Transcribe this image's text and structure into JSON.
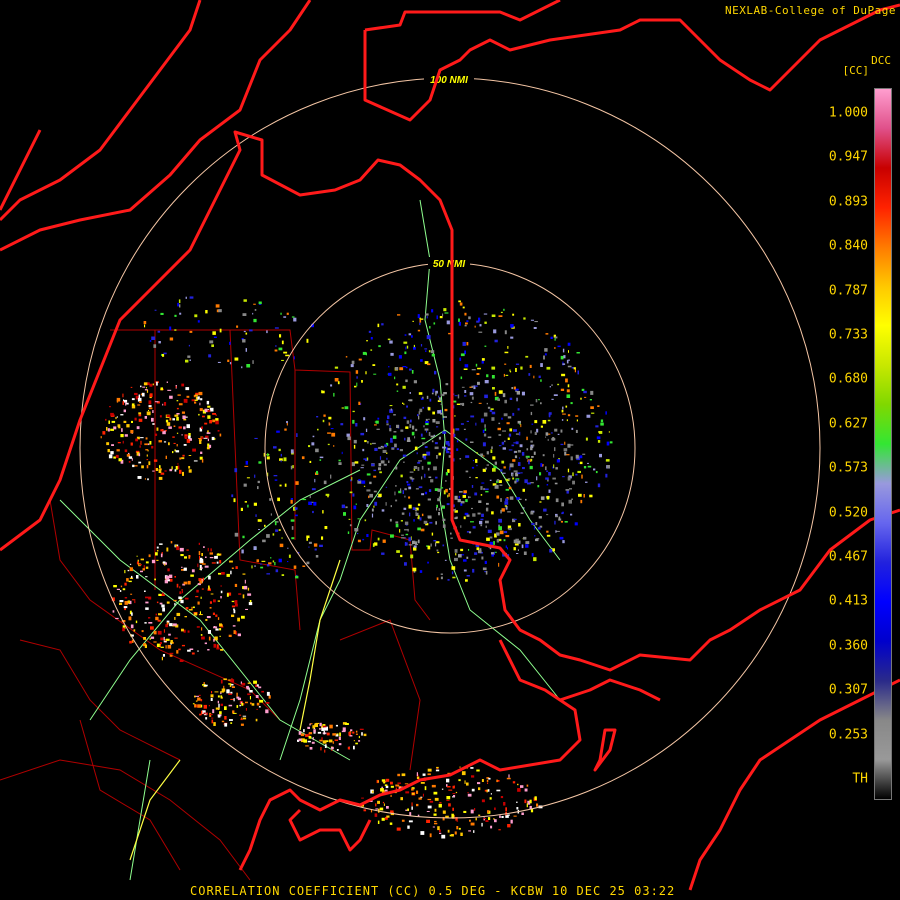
{
  "header": {
    "credit": "NEXLAB-College of DuPage"
  },
  "map": {
    "rings": [
      {
        "label": "100 NMI"
      },
      {
        "label": "50 NMI"
      }
    ],
    "colors": {
      "ring": "#f5c6a5",
      "ring_label": "#ffff00",
      "country_border": "#ff1a1a",
      "county_border": "#b00000",
      "road": "#8fff8f",
      "highway": "#ffff44"
    }
  },
  "colorbar": {
    "title": "DCC",
    "unit": "[CC]",
    "labels": [
      "1.000",
      "0.947",
      "0.893",
      "0.840",
      "0.787",
      "0.733",
      "0.680",
      "0.627",
      "0.573",
      "0.520",
      "0.467",
      "0.413",
      "0.360",
      "0.307",
      "0.253",
      "TH"
    ],
    "colors": [
      "#ff9ecf",
      "#e0508a",
      "#c80000",
      "#ff2200",
      "#ff7a00",
      "#ffc800",
      "#ffff00",
      "#c8e800",
      "#80d800",
      "#33e633",
      "#9999dd",
      "#6666ee",
      "#2222dd",
      "#0000ff",
      "#0000cc",
      "#2a2a8a",
      "#888888",
      "#999999",
      "#000000"
    ]
  },
  "footer": {
    "text": "CORRELATION COEFFICIENT (CC) 0.5 DEG - KCBW 10 DEC 25 03:22"
  }
}
